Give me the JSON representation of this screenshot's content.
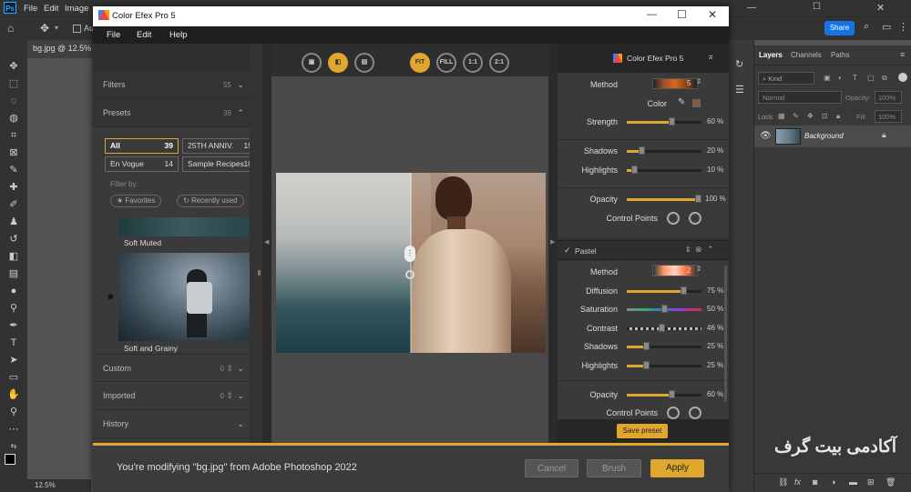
{
  "ps": {
    "logo": "Ps",
    "menu": [
      "File",
      "Edit",
      "Image"
    ],
    "doc_tab": "bg.jpg @ 12.5%",
    "options_label": "Au",
    "share_label": "Share",
    "status_zoom": "12.5%",
    "layers_tabs": [
      "Layers",
      "Channels",
      "Paths"
    ],
    "kind_label": "Kind",
    "blend_mode": "Normal",
    "opacity_label": "Opacity:",
    "opacity_value": "100%",
    "lock_label": "Lock:",
    "fill_label": "Fill:",
    "fill_value": "100%",
    "layer_name": "Background",
    "watermark": "آکادمی بیت گرف"
  },
  "plugin": {
    "title": "Color Efex Pro 5",
    "menu": [
      "File",
      "Edit",
      "Help"
    ],
    "left": {
      "filters_label": "Filters",
      "filters_count": "55",
      "presets_label": "Presets",
      "presets_count": "39",
      "preset_buttons": [
        {
          "label": "All",
          "count": "39"
        },
        {
          "label": "25TH ANNIV.",
          "count": "15"
        },
        {
          "label": "En Vogue",
          "count": "14"
        },
        {
          "label": "Sample Recipes",
          "count": "10"
        }
      ],
      "filter_by_label": "Filter by:",
      "favorites_label": "Favorites",
      "recently_used_label": "Recently used",
      "thumb1_label": "Soft Muted",
      "thumb2_label": "Soft and Grainy",
      "custom_label": "Custom",
      "custom_count": "0",
      "imported_label": "Imported",
      "imported_count": "0",
      "history_label": "History"
    },
    "toolbar": {
      "fit": "FIT",
      "fill": "FILL",
      "one": "1:1",
      "two": "2:1"
    },
    "right": {
      "brand": "Color Efex Pro 5",
      "method_label": "Method",
      "method_value": "5",
      "color_label": "Color",
      "strength_label": "Strength",
      "strength_value": "60 %",
      "strength_pct": 60,
      "shadows_label": "Shadows",
      "shadows_value": "20 %",
      "shadows_pct": 20,
      "highlights_label": "Highlights",
      "highlights_value": "10 %",
      "highlights_pct": 10,
      "opacity_label": "Opacity",
      "opacity_value": "100 %",
      "opacity_pct": 100,
      "control_points_label": "Control Points",
      "pastel_label": "Pastel",
      "method2_value": "2",
      "diffusion_label": "Diffusion",
      "diffusion_value": "75 %",
      "diffusion_pct": 75,
      "saturation_label": "Saturation",
      "saturation_value": "50 %",
      "saturation_pct": 50,
      "contrast_label": "Contrast",
      "contrast_value": "46 %",
      "contrast_pct": 46,
      "shadows2_value": "25 %",
      "shadows2_pct": 25,
      "highlights2_value": "25 %",
      "highlights2_pct": 25,
      "opacity2_value": "60 %",
      "opacity2_pct": 60,
      "save_preset": "Save preset"
    },
    "bottom": {
      "status": "You're modifying \"bg.jpg\" from Adobe Photoshop 2022",
      "cancel": "Cancel",
      "brush": "Brush",
      "apply": "Apply"
    }
  },
  "colors": {
    "accent": "#e0a72f"
  }
}
